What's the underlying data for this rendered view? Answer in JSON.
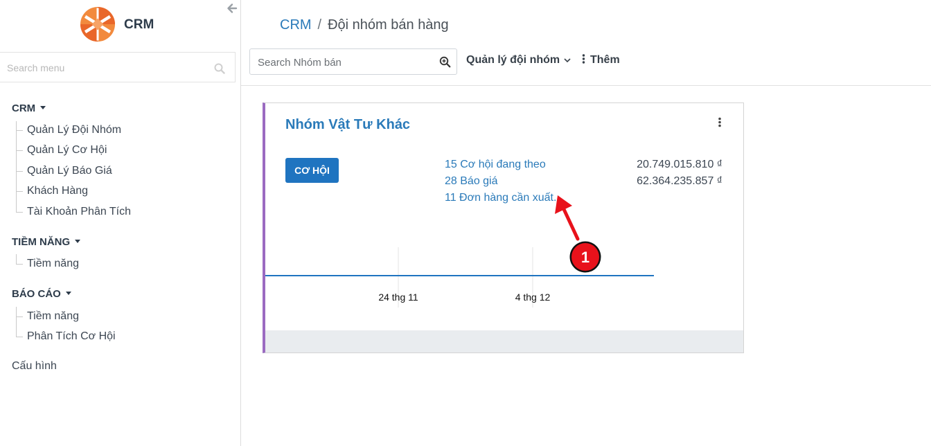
{
  "sidebar": {
    "app_name": "CRM",
    "search_placeholder": "Search menu",
    "sections": [
      {
        "title": "CRM",
        "items": [
          "Quản Lý Đội Nhóm",
          "Quản Lý Cơ Hội",
          "Quản Lý Báo Giá",
          "Khách Hàng",
          "Tài Khoản Phân Tích"
        ]
      },
      {
        "title": "TIỀM NĂNG",
        "items": [
          "Tiềm năng"
        ]
      },
      {
        "title": "BÁO CÁO",
        "items": [
          "Tiềm năng",
          "Phân Tích Cơ Hội"
        ]
      }
    ],
    "config_label": "Cấu hình"
  },
  "breadcrumb": {
    "root": "CRM",
    "separator": "/",
    "current": "Đội nhóm bán hàng"
  },
  "toolbar": {
    "search_placeholder": "Search Nhóm bán",
    "manage_label": "Quản lý đội nhóm",
    "more_label": "Thêm"
  },
  "card": {
    "title": "Nhóm Vật Tư Khác",
    "button_label": "CƠ HỘI",
    "stats": [
      {
        "label": "15 Cơ hội đang theo",
        "amount": "20.749.015.810 ₫"
      },
      {
        "label": "28 Báo giá",
        "amount": "62.364.235.857 ₫"
      },
      {
        "label": "11 Đơn hàng cần xuất...",
        "amount": ""
      }
    ],
    "graph_ticks": [
      "24 thg 11",
      "4 thg 12"
    ]
  },
  "annotation": {
    "number": "1"
  },
  "colors": {
    "accent": "#2a7ab9",
    "button": "#1f74c0",
    "card_border": "#9b6bc1",
    "annotation_red": "#e8121b"
  },
  "icons": [
    "arrow-left-icon",
    "crm-logo",
    "search-icon",
    "zoom-icon",
    "chevron-down-icon",
    "vertical-dots-icon"
  ]
}
